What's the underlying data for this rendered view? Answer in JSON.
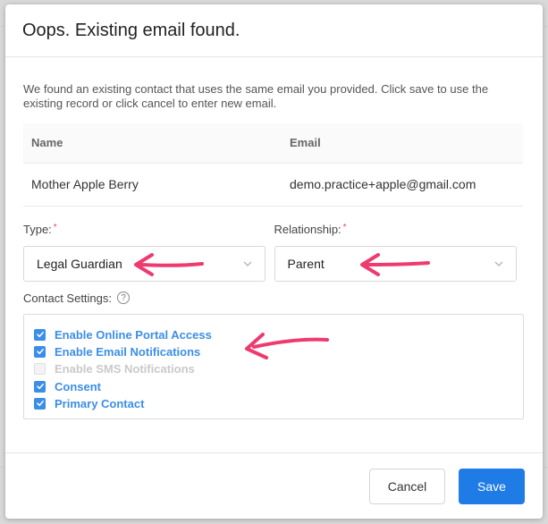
{
  "dialog": {
    "title": "Oops. Existing email found.",
    "intro": "We found an existing contact that uses the same email you provided. Click save to use the existing record or click cancel to enter new email."
  },
  "match_table": {
    "headers": {
      "name": "Name",
      "email": "Email"
    },
    "row": {
      "name": "Mother Apple Berry",
      "email": "demo.practice+apple@gmail.com"
    }
  },
  "type_field": {
    "label": "Type:",
    "required_mark": "*",
    "value": "Legal Guardian"
  },
  "relationship_field": {
    "label": "Relationship:",
    "required_mark": "*",
    "value": "Parent"
  },
  "contact_settings": {
    "label": "Contact Settings:",
    "help_glyph": "?",
    "options": [
      {
        "label": "Enable Online Portal Access",
        "checked": true,
        "disabled": false
      },
      {
        "label": "Enable Email Notifications",
        "checked": true,
        "disabled": false
      },
      {
        "label": "Enable SMS Notifications",
        "checked": false,
        "disabled": true
      },
      {
        "label": "Consent",
        "checked": true,
        "disabled": false
      },
      {
        "label": "Primary Contact",
        "checked": true,
        "disabled": false
      }
    ]
  },
  "footer": {
    "cancel_label": "Cancel",
    "save_label": "Save"
  },
  "colors": {
    "accent": "#1f7be6",
    "link": "#3b8ee8",
    "annotation_arrow": "#ee3a6f",
    "required": "#e5484d"
  }
}
